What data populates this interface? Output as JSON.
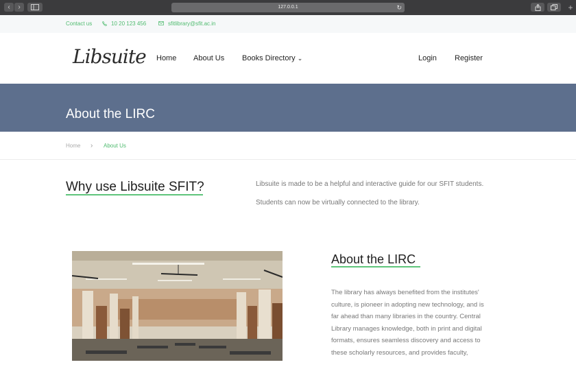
{
  "browser": {
    "url": "127.0.0.1",
    "back_icon": "chevron-left-icon",
    "forward_icon": "chevron-right-icon",
    "sidebar_icon": "sidebar-icon",
    "reload_icon": "reload-icon",
    "share_icon": "share-icon",
    "tabs_icon": "tabs-icon",
    "new_tab_label": "+"
  },
  "topbar": {
    "contact_label": "Contact us",
    "phone": "10 20 123 456",
    "email": "sfitlibrary@sfit.ac.in",
    "phone_icon": "phone-icon",
    "email_icon": "envelope-icon"
  },
  "header": {
    "logo": "Libsuite",
    "nav": {
      "home": "Home",
      "about": "About Us",
      "books": "Books Directory",
      "books_caret": "⌄",
      "login": "Login",
      "register": "Register"
    }
  },
  "banner": {
    "title": "About the LIRC"
  },
  "breadcrumb": {
    "home": "Home",
    "separator": "›",
    "current": "About Us"
  },
  "why": {
    "title": "Why use Libsuite SFIT?",
    "line1": "Libsuite is made to be a helpful and interactive guide for our SFIT students.",
    "line2": "Students can now be virtually connected to the library."
  },
  "about": {
    "title": "About the LIRC",
    "lines": [
      "The library has always benefited from the institutes'",
      "culture, is pioneer in adopting new technology, and is",
      "far ahead than many libraries in the country. Central",
      "Library manages knowledge, both in print and digital",
      "formats, ensures seamless discovery and access to",
      "these scholarly resources, and provides faculty,"
    ]
  },
  "colors": {
    "accent": "#4fbb6f",
    "banner": "#5d6f8d",
    "chrome": "#3b3b3d"
  }
}
